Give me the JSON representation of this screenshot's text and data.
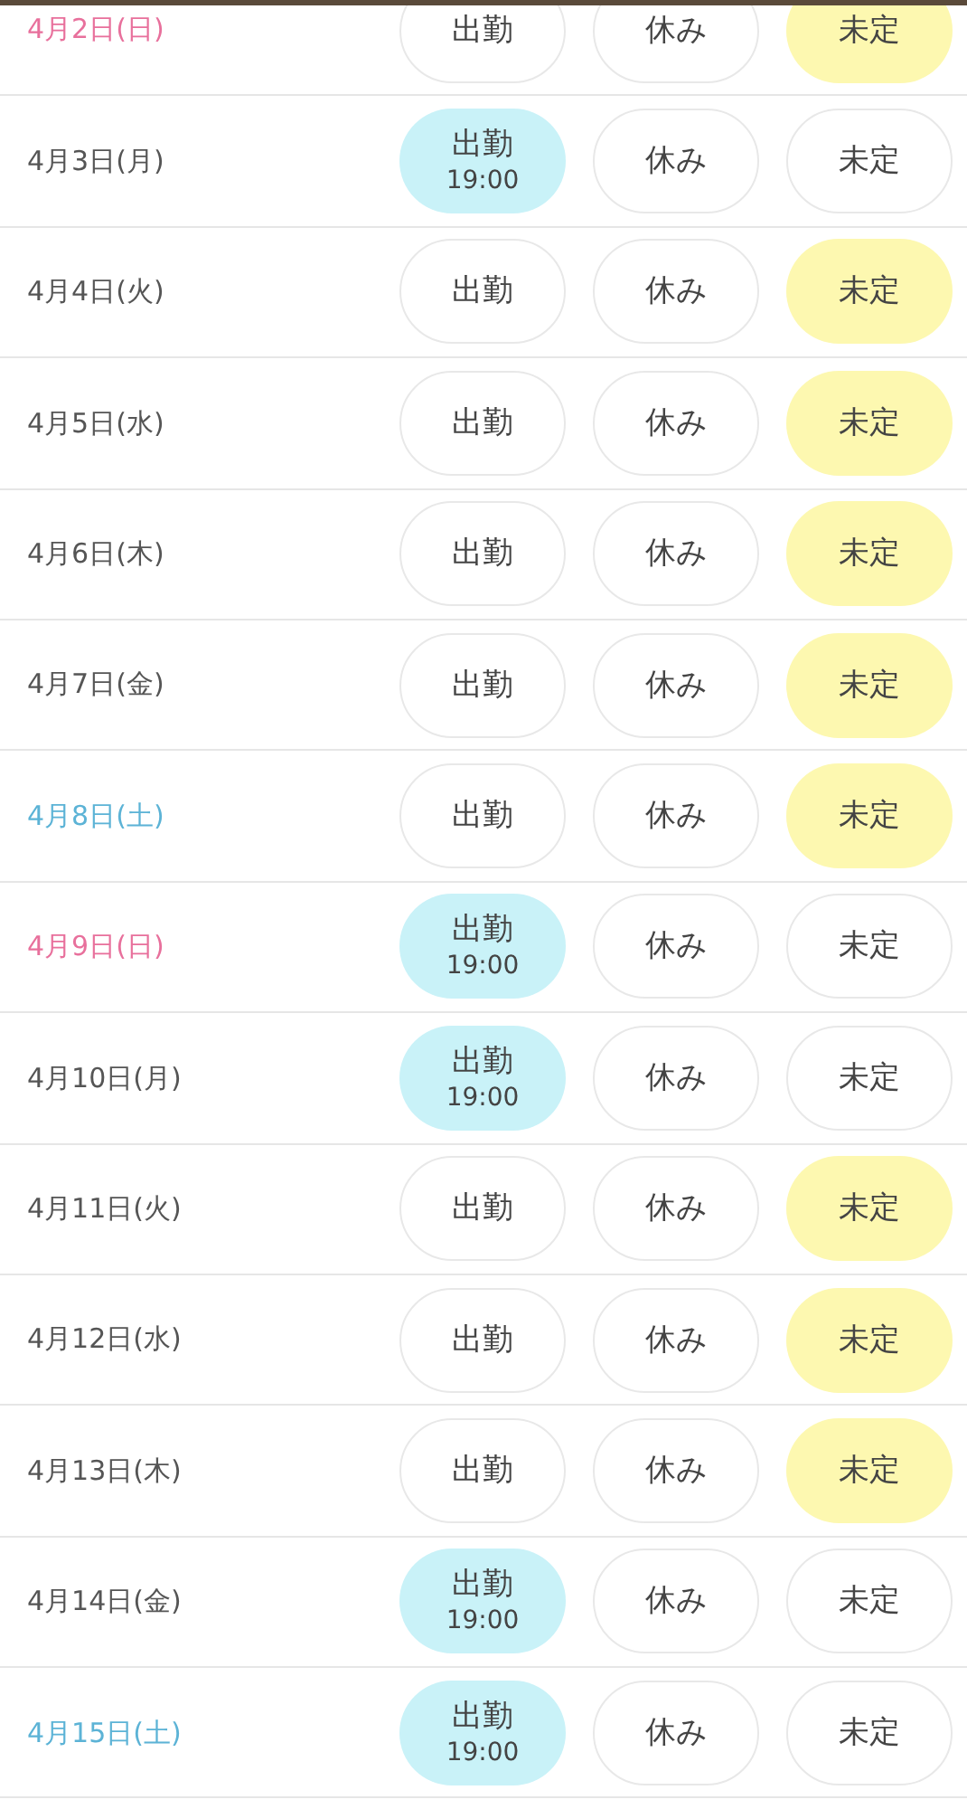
{
  "rows": [
    {
      "date": "4月2日(日)",
      "kind": "sun",
      "options": [
        {
          "label": "出勤",
          "selected": false
        },
        {
          "label": "休み",
          "selected": false
        },
        {
          "label": "未定",
          "selected": true
        }
      ]
    },
    {
      "date": "4月3日(月)",
      "kind": "weekday",
      "options": [
        {
          "label": "出勤",
          "selected": true,
          "time": "19:00"
        },
        {
          "label": "休み",
          "selected": false
        },
        {
          "label": "未定",
          "selected": false
        }
      ]
    },
    {
      "date": "4月4日(火)",
      "kind": "weekday",
      "options": [
        {
          "label": "出勤",
          "selected": false
        },
        {
          "label": "休み",
          "selected": false
        },
        {
          "label": "未定",
          "selected": true
        }
      ]
    },
    {
      "date": "4月5日(水)",
      "kind": "weekday",
      "options": [
        {
          "label": "出勤",
          "selected": false
        },
        {
          "label": "休み",
          "selected": false
        },
        {
          "label": "未定",
          "selected": true
        }
      ]
    },
    {
      "date": "4月6日(木)",
      "kind": "weekday",
      "options": [
        {
          "label": "出勤",
          "selected": false
        },
        {
          "label": "休み",
          "selected": false
        },
        {
          "label": "未定",
          "selected": true
        }
      ]
    },
    {
      "date": "4月7日(金)",
      "kind": "weekday",
      "options": [
        {
          "label": "出勤",
          "selected": false
        },
        {
          "label": "休み",
          "selected": false
        },
        {
          "label": "未定",
          "selected": true
        }
      ]
    },
    {
      "date": "4月8日(土)",
      "kind": "sat",
      "options": [
        {
          "label": "出勤",
          "selected": false
        },
        {
          "label": "休み",
          "selected": false
        },
        {
          "label": "未定",
          "selected": true
        }
      ]
    },
    {
      "date": "4月9日(日)",
      "kind": "sun",
      "options": [
        {
          "label": "出勤",
          "selected": true,
          "time": "19:00"
        },
        {
          "label": "休み",
          "selected": false
        },
        {
          "label": "未定",
          "selected": false
        }
      ]
    },
    {
      "date": "4月10日(月)",
      "kind": "weekday",
      "options": [
        {
          "label": "出勤",
          "selected": true,
          "time": "19:00"
        },
        {
          "label": "休み",
          "selected": false
        },
        {
          "label": "未定",
          "selected": false
        }
      ]
    },
    {
      "date": "4月11日(火)",
      "kind": "weekday",
      "options": [
        {
          "label": "出勤",
          "selected": false
        },
        {
          "label": "休み",
          "selected": false
        },
        {
          "label": "未定",
          "selected": true
        }
      ]
    },
    {
      "date": "4月12日(水)",
      "kind": "weekday",
      "options": [
        {
          "label": "出勤",
          "selected": false
        },
        {
          "label": "休み",
          "selected": false
        },
        {
          "label": "未定",
          "selected": true
        }
      ]
    },
    {
      "date": "4月13日(木)",
      "kind": "weekday",
      "options": [
        {
          "label": "出勤",
          "selected": false
        },
        {
          "label": "休み",
          "selected": false
        },
        {
          "label": "未定",
          "selected": true
        }
      ]
    },
    {
      "date": "4月14日(金)",
      "kind": "weekday",
      "options": [
        {
          "label": "出勤",
          "selected": true,
          "time": "19:00"
        },
        {
          "label": "休み",
          "selected": false
        },
        {
          "label": "未定",
          "selected": false
        }
      ]
    },
    {
      "date": "4月15日(土)",
      "kind": "sat",
      "options": [
        {
          "label": "出勤",
          "selected": true,
          "time": "19:00"
        },
        {
          "label": "休み",
          "selected": false
        },
        {
          "label": "未定",
          "selected": false
        }
      ]
    }
  ]
}
